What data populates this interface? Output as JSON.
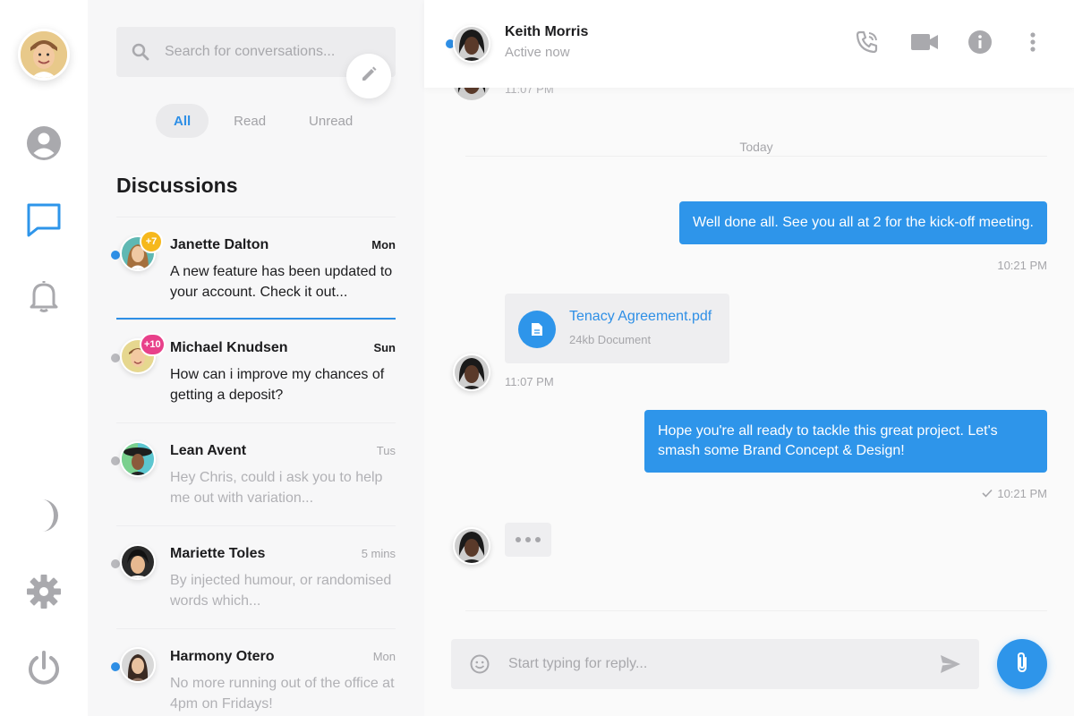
{
  "colors": {
    "accent": "#2e95ea",
    "online": "#2e8fe6",
    "badge_yellow": "#f6b81c",
    "badge_pink": "#e8408a",
    "rail_icon": "#a9a9ad"
  },
  "rail": {
    "items": [
      {
        "name": "profile",
        "icon": "user-circle-icon"
      },
      {
        "name": "messages",
        "icon": "chat-bubble-icon",
        "active": true
      },
      {
        "name": "notifications",
        "icon": "bell-icon"
      },
      {
        "name": "dark-mode",
        "icon": "moon-icon"
      },
      {
        "name": "settings",
        "icon": "gear-icon"
      },
      {
        "name": "logout",
        "icon": "power-icon"
      }
    ]
  },
  "search": {
    "placeholder": "Search for conversations..."
  },
  "filters": [
    "All",
    "Read",
    "Unread"
  ],
  "discussions": {
    "title": "Discussions",
    "items": [
      {
        "name": "Janette Dalton",
        "time": "Mon",
        "message": "A new feature has been updated to your account. Check it out...",
        "badge": "+7",
        "online": true,
        "unread": true
      },
      {
        "name": "Michael Knudsen",
        "time": "Sun",
        "message": "How can i improve my chances of getting a deposit?",
        "badge": "+10",
        "online": false,
        "unread": true
      },
      {
        "name": "Lean Avent",
        "time": "Tus",
        "message": "Hey Chris, could i ask you to help me out with variation...",
        "online": false,
        "unread": false
      },
      {
        "name": "Mariette Toles",
        "time": "5 mins",
        "message": "By injected humour, or randomised words which...",
        "online": false,
        "unread": false
      },
      {
        "name": "Harmony Otero",
        "time": "Mon",
        "message": "No more running out of the office at 4pm on Fridays!",
        "online": true,
        "unread": false
      }
    ]
  },
  "chat": {
    "contact": {
      "name": "Keith Morris",
      "status": "Active now"
    },
    "peek_time": "11:07 PM",
    "day_separator": "Today",
    "messages": [
      {
        "text": "Well done all. See you all at 2 for the kick-off meeting.",
        "time": "10:21 PM"
      },
      {
        "file_name": "Tenacy Agreement.pdf",
        "file_size": "24kb Document",
        "time": "11:07 PM"
      },
      {
        "text": "Hope you're all ready to tackle this great project. Let's smash some Brand Concept & Design!",
        "time": "10:21 PM",
        "read": true
      }
    ],
    "composer": {
      "placeholder": "Start typing for reply..."
    }
  }
}
